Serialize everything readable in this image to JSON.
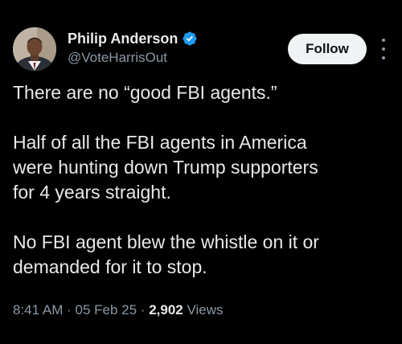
{
  "author": {
    "display_name": "Philip Anderson",
    "handle": "@VoteHarrisOut",
    "verified_icon": "verified-badge-icon",
    "avatar": "profile-photo"
  },
  "actions": {
    "follow_label": "Follow",
    "more_icon": "more-options-icon"
  },
  "tweet": {
    "paragraphs": [
      "There are no “good FBI agents.”",
      "Half of all the FBI agents in America\nwere hunting down Trump supporters\nfor 4 years straight.",
      "No FBI agent blew the whistle on it or\ndemanded for it to stop."
    ]
  },
  "meta": {
    "time": "8:41 AM",
    "separator": "·",
    "date": "05 Feb 25",
    "views_count": "2,902",
    "views_label": "Views"
  },
  "colors": {
    "background": "#000000",
    "text": "#e7e9ea",
    "secondary": "#8b98a5",
    "verified": "#1d9bf0",
    "follow_bg": "#eff3f4"
  }
}
